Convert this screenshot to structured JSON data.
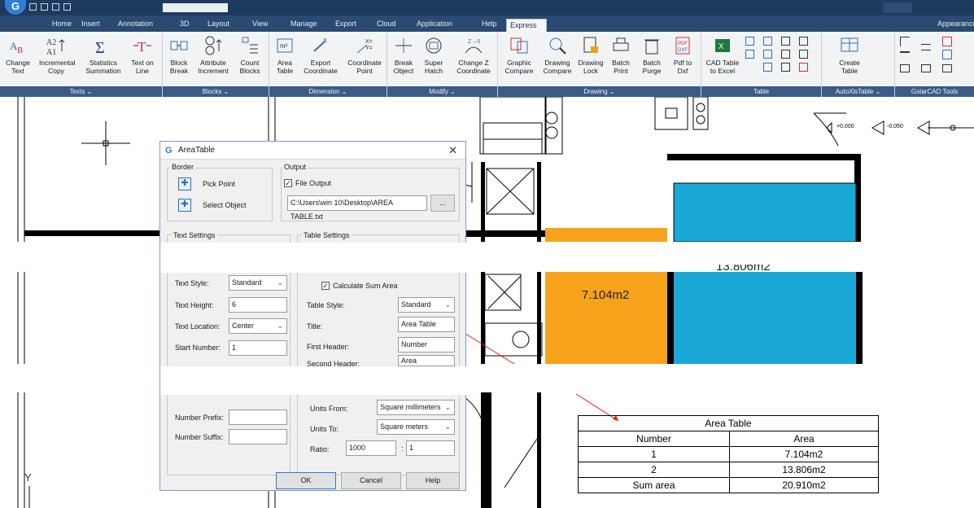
{
  "app": {
    "logo": "G"
  },
  "tabs": [
    "Home",
    "Insert",
    "Annotation",
    "3D",
    "Layout",
    "View",
    "Manage",
    "Export",
    "Cloud",
    "Application",
    "Help",
    "Express"
  ],
  "active_tab": "Express",
  "appearance_label": "Appearance",
  "ribbon": {
    "groups": [
      {
        "name": "Texts",
        "footer": "Texts ⌄",
        "buttons": [
          "Change Text",
          "Incremental Copy",
          "Statistics Summation",
          "Text on Line"
        ]
      },
      {
        "name": "Blocks",
        "footer": "Blocks ⌄",
        "buttons": [
          "Block Break",
          "Attribute Increment",
          "Count Blocks"
        ]
      },
      {
        "name": "Dimension",
        "footer": "Dimension ⌄",
        "buttons": [
          "Area Table",
          "Export Coordinate",
          "Coordinate Point"
        ]
      },
      {
        "name": "Modify",
        "footer": "Modify ⌄",
        "buttons": [
          "Break Object",
          "Super Hatch",
          "Change Z Coordinate"
        ]
      },
      {
        "name": "Drawing",
        "footer": "Drawing ⌄",
        "buttons": [
          "Graphic Compare",
          "Drawing Compare",
          "Drawing Lock",
          "Batch Print",
          "Batch Purge",
          "Pdf to Dxf"
        ]
      },
      {
        "name": "Table",
        "footer": "Table",
        "buttons": [
          "CAD Table to Excel"
        ]
      },
      {
        "name": "AutoXlsTable",
        "footer": "AutoXlsTable ⌄",
        "buttons": [
          "Create Table"
        ]
      },
      {
        "name": "GstarCAD Tools",
        "footer": "GstarCAD Tools",
        "buttons": []
      }
    ]
  },
  "drawing": {
    "room1_area": "7.104m2",
    "room2_area": "13.806m2",
    "level1": "+0.000",
    "level2": "-0.050",
    "y_axis": "Y"
  },
  "dialog": {
    "title": "AreaTable",
    "border": {
      "label": "Border",
      "pick_point": "Pick Point",
      "select_object": "Select Object"
    },
    "output": {
      "label": "Output",
      "file_output": "File Output",
      "file_output_checked": true,
      "path": "C:\\Users\\win 10\\Desktop\\AREA TABLE.txt",
      "browse": "..."
    },
    "text_settings": {
      "label": "Text Settings",
      "text_style_label": "Text Style:",
      "text_style": "Standard",
      "text_height_label": "Text Height:",
      "text_height": "6",
      "text_location_label": "Text Location:",
      "text_location": "Center",
      "start_number_label": "Start Number:",
      "start_number": "1",
      "number_prefix_label": "Number Prefix:",
      "number_prefix": "",
      "number_suffix_label": "Number Suffix:",
      "number_suffix": ""
    },
    "table_settings": {
      "label": "Table Settings",
      "calc_sum": "Calculate Sum Area",
      "calc_sum_checked": true,
      "table_style_label": "Table Style:",
      "table_style": "Standard",
      "title_label": "Title:",
      "title": "Area Table",
      "first_header_label": "First Header:",
      "first_header": "Number",
      "second_header_label": "Second Header:",
      "second_header": "Area",
      "units_from_label": "Units From:",
      "units_from": "Square millimeters",
      "units_to_label": "Units To:",
      "units_to": "Square meters",
      "ratio_label": "Ratio:",
      "ratio_a": "1000",
      "ratio_sep": ":",
      "ratio_b": "1"
    },
    "buttons": {
      "ok": "OK",
      "cancel": "Cancel",
      "help": "Help"
    }
  },
  "area_table": {
    "title": "Area Table",
    "headers": [
      "Number",
      "Area"
    ],
    "rows": [
      [
        "1",
        "7.104m2"
      ],
      [
        "2",
        "13.806m2"
      ]
    ],
    "sum_label": "Sum area",
    "sum_value": "20.910m2"
  },
  "colors": {
    "room1": "#f7a21b",
    "room2": "#1aa9d6",
    "ribbon_footer": "#3b5c86"
  }
}
